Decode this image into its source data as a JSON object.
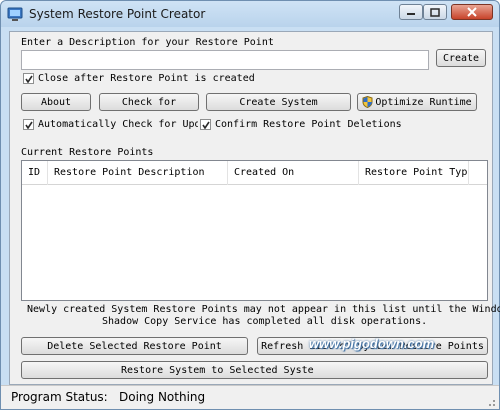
{
  "window": {
    "title": "System Restore Point Creator",
    "controls": {
      "minimize_icon": "minimize-icon",
      "maximize_icon": "maximize-icon",
      "close_icon": "close-icon"
    }
  },
  "description": {
    "label": "Enter a Description for your Restore Point",
    "value": "",
    "create_label": "Create"
  },
  "close_after_checkbox": {
    "label": "Close after Restore Point is created",
    "checked": true
  },
  "toolbar": {
    "about_label": "About",
    "check_for_label": "Check for",
    "create_system_label": "Create System",
    "optimize_runtime_label": "Optimize Runtime",
    "optimize_icon": "shield-icon"
  },
  "auto_check_checkbox": {
    "label": "Automatically Check for Updat",
    "checked": true
  },
  "confirm_deletions_checkbox": {
    "label": "Confirm Restore Point Deletions",
    "checked": true
  },
  "restore_points": {
    "section_label": "Current Restore Points",
    "columns": [
      "ID",
      "Restore Point Description",
      "Created On",
      "Restore Point Type"
    ],
    "rows": []
  },
  "notice": {
    "line1": "Newly created System Restore Points may not appear in this list until the Windows",
    "line2": "Shadow Copy Service has completed all disk operations."
  },
  "actions": {
    "delete_label": "Delete Selected Restore Point",
    "refresh_label": "Refresh List of System Restore Points",
    "restore_label": "Restore System to Selected Syste"
  },
  "status": {
    "label": "Program Status:",
    "value": "Doing Nothing"
  },
  "watermark": {
    "text": "www.pigodown.com"
  },
  "colors": {
    "title_bar": "#b9d3ec",
    "client_bg": "#f0f0f0",
    "close_button": "#c7432a",
    "checkmark": "#2a2a2a"
  }
}
